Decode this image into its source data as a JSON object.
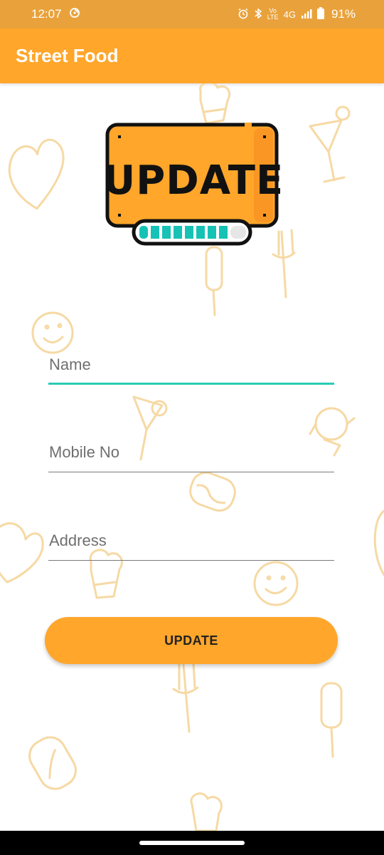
{
  "status_bar": {
    "time": "12:07",
    "network": "4G",
    "volte": "Vo LTE",
    "battery": "91%"
  },
  "app_bar": {
    "title": "Street Food"
  },
  "logo": {
    "text": "UPDATE"
  },
  "form": {
    "name_placeholder": "Name",
    "mobile_placeholder": "Mobile No",
    "address_placeholder": "Address",
    "name_value": "",
    "mobile_value": "",
    "address_value": ""
  },
  "update_button": {
    "label": "UPDATE"
  },
  "colors": {
    "primary": "#FFA62B",
    "status_bar": "#E9A23B",
    "accent": "#2ACBB5",
    "doodle": "#F6D9A4"
  }
}
